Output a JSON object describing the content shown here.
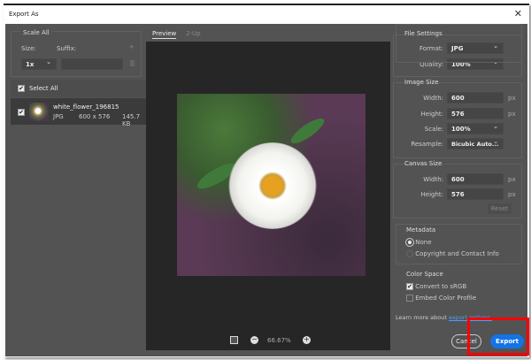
{
  "window": {
    "title": "Export As"
  },
  "left": {
    "scale_all": "Scale All",
    "size_label": "Size:",
    "suffix_label": "Suffix:",
    "size_value": "1x",
    "suffix_value": "",
    "select_all": "Select All",
    "file": {
      "name": "white_flower_196815",
      "format": "JPG",
      "dimensions": "600 x 576",
      "size": "145.7 KB"
    }
  },
  "preview": {
    "tabs": [
      "Preview",
      "2-Up"
    ],
    "active_tab": "Preview",
    "zoom": "66.67%"
  },
  "file_settings": {
    "title": "File Settings",
    "format_label": "Format:",
    "format": "JPG",
    "quality_label": "Quality:",
    "quality": "100%"
  },
  "image_size": {
    "title": "Image Size",
    "width_label": "Width:",
    "width": "600",
    "height_label": "Height:",
    "height": "576",
    "unit": "px",
    "scale_label": "Scale:",
    "scale": "100%",
    "resample_label": "Resample:",
    "resample": "Bicubic Auto..."
  },
  "canvas_size": {
    "title": "Canvas Size",
    "width_label": "Width:",
    "width": "600",
    "height_label": "Height:",
    "height": "576",
    "unit": "px",
    "reset": "Reset"
  },
  "metadata": {
    "title": "Metadata",
    "options": [
      "None",
      "Copyright and Contact Info"
    ],
    "selected": "None"
  },
  "color_space": {
    "title": "Color Space",
    "convert": "Convert to sRGB",
    "convert_checked": true,
    "embed": "Embed Color Profile",
    "embed_checked": false
  },
  "footer": {
    "learn_more": "Learn more about",
    "link": "export options.",
    "cancel": "Cancel",
    "export": "Export"
  },
  "colors": {
    "accent": "#1473e6",
    "highlight": "#ff0000",
    "link": "#4a9eff"
  }
}
